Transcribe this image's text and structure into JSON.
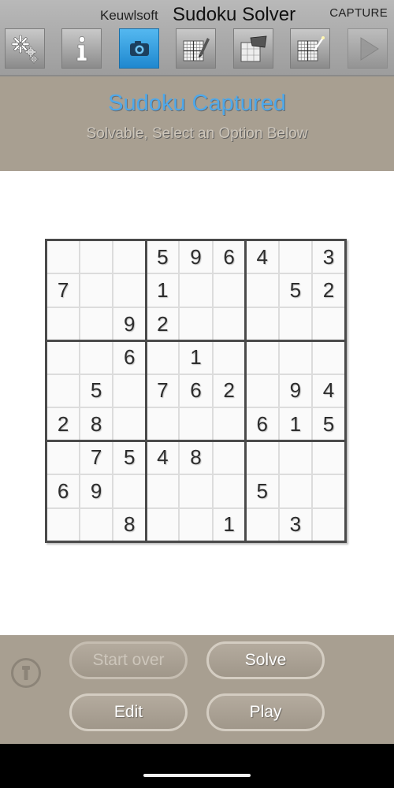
{
  "header": {
    "brand": "Keuwlsoft",
    "app_title": "Sudoku Solver",
    "mode": "CAPTURE"
  },
  "toolbar": {
    "items": [
      {
        "name": "settings",
        "icon": "gear-icon",
        "active": false
      },
      {
        "name": "info",
        "icon": "info-icon",
        "active": false
      },
      {
        "name": "capture",
        "icon": "camera-icon",
        "active": true
      },
      {
        "name": "edit-grid",
        "icon": "pencil-grid-icon",
        "active": false
      },
      {
        "name": "import-image",
        "icon": "image-grid-icon",
        "active": false
      },
      {
        "name": "auto-solve",
        "icon": "wand-grid-icon",
        "active": false
      },
      {
        "name": "play",
        "icon": "play-icon",
        "active": false,
        "disabled": true
      }
    ]
  },
  "status": {
    "title": "Sudoku Captured",
    "subtitle": "Solvable, Select an Option Below"
  },
  "grid": {
    "rows": [
      [
        "",
        "",
        "",
        "5",
        "9",
        "6",
        "4",
        "",
        "3"
      ],
      [
        "7",
        "",
        "",
        "1",
        "",
        "",
        "",
        "5",
        "2"
      ],
      [
        "",
        "",
        "9",
        "2",
        "",
        "",
        "",
        "",
        ""
      ],
      [
        "",
        "",
        "6",
        "",
        "1",
        "",
        "",
        "",
        ""
      ],
      [
        "",
        "5",
        "",
        "7",
        "6",
        "2",
        "",
        "9",
        "4"
      ],
      [
        "2",
        "8",
        "",
        "",
        "",
        "",
        "6",
        "1",
        "5"
      ],
      [
        "",
        "7",
        "5",
        "4",
        "8",
        "",
        "",
        "",
        ""
      ],
      [
        "6",
        "9",
        "",
        "",
        "",
        "",
        "5",
        "",
        ""
      ],
      [
        "",
        "",
        "8",
        "",
        "",
        "1",
        "",
        "3",
        ""
      ]
    ]
  },
  "actions": {
    "start_over": "Start over",
    "solve": "Solve",
    "edit": "Edit",
    "play": "Play",
    "start_over_enabled": false
  },
  "colors": {
    "accent_blue": "#4ea8ea",
    "panel_tan": "#a89f91",
    "toolbar_active": "#1f88cf"
  }
}
